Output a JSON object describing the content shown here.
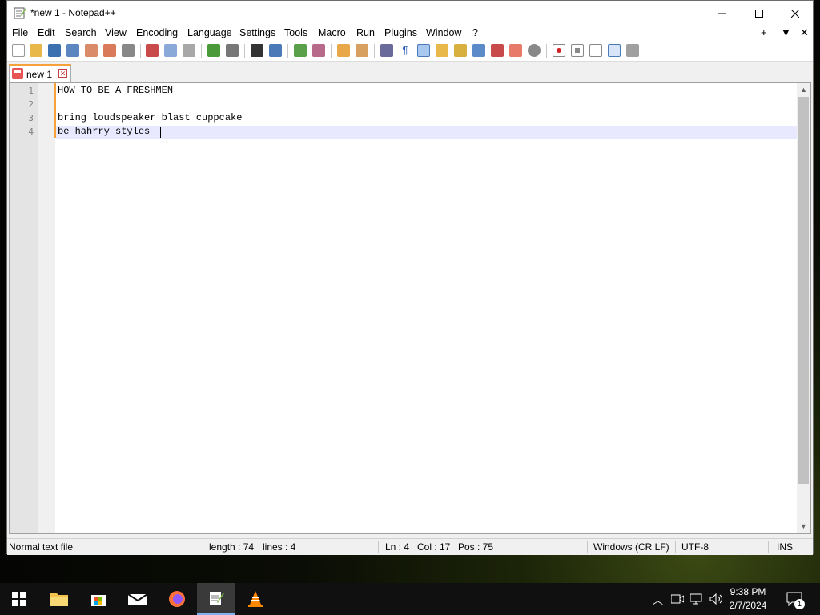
{
  "window": {
    "title": "*new 1 - Notepad++"
  },
  "menu": {
    "items": [
      "File",
      "Edit",
      "Search",
      "View",
      "Encoding",
      "Language",
      "Settings",
      "Tools",
      "Macro",
      "Run",
      "Plugins",
      "Window",
      "?"
    ],
    "right": [
      "+",
      "▼",
      "✕"
    ]
  },
  "tab": {
    "label": "new 1"
  },
  "editor": {
    "lines": [
      {
        "number": "1",
        "text": "HOW TO BE A FRESHMEN"
      },
      {
        "number": "2",
        "text": ""
      },
      {
        "number": "3",
        "text": "bring loudspeaker blast cuppcake"
      },
      {
        "number": "4",
        "text": "be hahrry styles"
      }
    ]
  },
  "status": {
    "filetype": "Normal text file",
    "length": "length : 74",
    "lines": "lines : 4",
    "ln": "Ln : 4",
    "col": "Col : 17",
    "pos": "Pos : 75",
    "eol": "Windows (CR LF)",
    "encoding": "UTF-8",
    "mode": "INS"
  },
  "taskbar": {
    "time": "9:38 PM",
    "date": "2/7/2024",
    "notification_count": "1"
  },
  "colors": {
    "accent": "#f7a13a",
    "current_line": "#e8e8ff",
    "taskbar": "#101010"
  }
}
